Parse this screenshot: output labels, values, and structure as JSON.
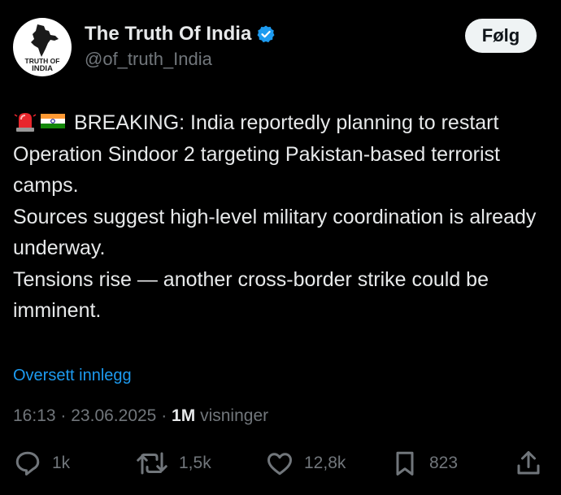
{
  "header": {
    "avatar_text_line1": "TRUTH OF",
    "avatar_text_line2": "INDIA",
    "display_name": "The Truth Of India",
    "handle": "@of_truth_India",
    "follow_label": "Følg"
  },
  "tweet": {
    "paragraphs": [
      "BREAKING: India reportedly planning to restart Operation Sindoor 2 targeting Pakistan-based terrorist camps.",
      "Sources suggest high-level military coordination is already underway.",
      "Tensions rise — another cross-border strike could be imminent."
    ],
    "emojis": [
      "police-light-icon",
      "india-flag-icon"
    ],
    "translate_label": "Oversett innlegg"
  },
  "meta": {
    "time": "16:13",
    "date": "23.06.2025",
    "views_count": "1M",
    "views_label": "visninger"
  },
  "actions": {
    "replies": "1k",
    "reposts": "1,5k",
    "likes": "12,8k",
    "bookmarks": "823"
  },
  "colors": {
    "background": "#000000",
    "text": "#e7e9ea",
    "muted": "#71767b",
    "link": "#1d9bf0",
    "verified": "#1d9bf0"
  }
}
